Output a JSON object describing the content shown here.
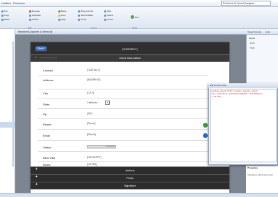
{
  "window": {
    "title": "Untitled - Proforma",
    "search_text": "Proforma 10 Visual Designer"
  },
  "ribbon": {
    "group_edit": "Edit",
    "group_layout": "Layout",
    "group_tools": "Tools",
    "buttons_col1": [
      "Cut",
      "Copy",
      "Paste"
    ],
    "buttons_col2": [
      "Remove",
      "Duplicate",
      "Stretch"
    ],
    "buttons_col3": [
      "Move",
      "Lock",
      "Align"
    ],
    "buttons_col4": [
      "Bring to Front",
      "Send to Back",
      "Group"
    ],
    "buttons_col5": [
      "Size",
      "Space",
      "Center"
    ],
    "run_label": "Run"
  },
  "doc_tab": "ResearchCustomer 10 Items 95",
  "right_pane": {
    "tab1": "Visual Formats",
    "tab2": "Lists",
    "rows": [
      "Layout",
      "Form",
      "Style"
    ],
    "props_title": "Properties",
    "props_text": "Indicates a client side script"
  },
  "form": {
    "back_label": "Back",
    "title": "[CONTACT]",
    "section_title": "Client Information",
    "section_tag": "[No] [SITE]_[Rule]",
    "fields": [
      {
        "label": "Contact",
        "value": "[CONTACT]"
      },
      {
        "label": "Address",
        "value": "[ADDRESS]"
      },
      {
        "label": "City",
        "value": "[CITY]"
      },
      {
        "label": "State",
        "value": "California"
      },
      {
        "label": "Zip",
        "value": "[ZIP]"
      },
      {
        "label": "Phone",
        "value": "[Phone]"
      },
      {
        "label": "Email",
        "value": "[EMAIL]"
      },
      {
        "label": "Status",
        "value": "Unknown"
      },
      {
        "label": "Next Visit",
        "value": "[NEXTAPPT]"
      },
      {
        "label": "Notes",
        "value": "[NOTES]"
      }
    ],
    "sections": [
      "Actions",
      "Photo",
      "Signature"
    ]
  },
  "popup": {
    "title": "Edit Control Code",
    "code_line1": "window.open('http://maps.google.com/m",
    "code_line2": "  ?q='+document.getElementById(' FinfAddres",
    "code_line3": "  ).value);"
  }
}
